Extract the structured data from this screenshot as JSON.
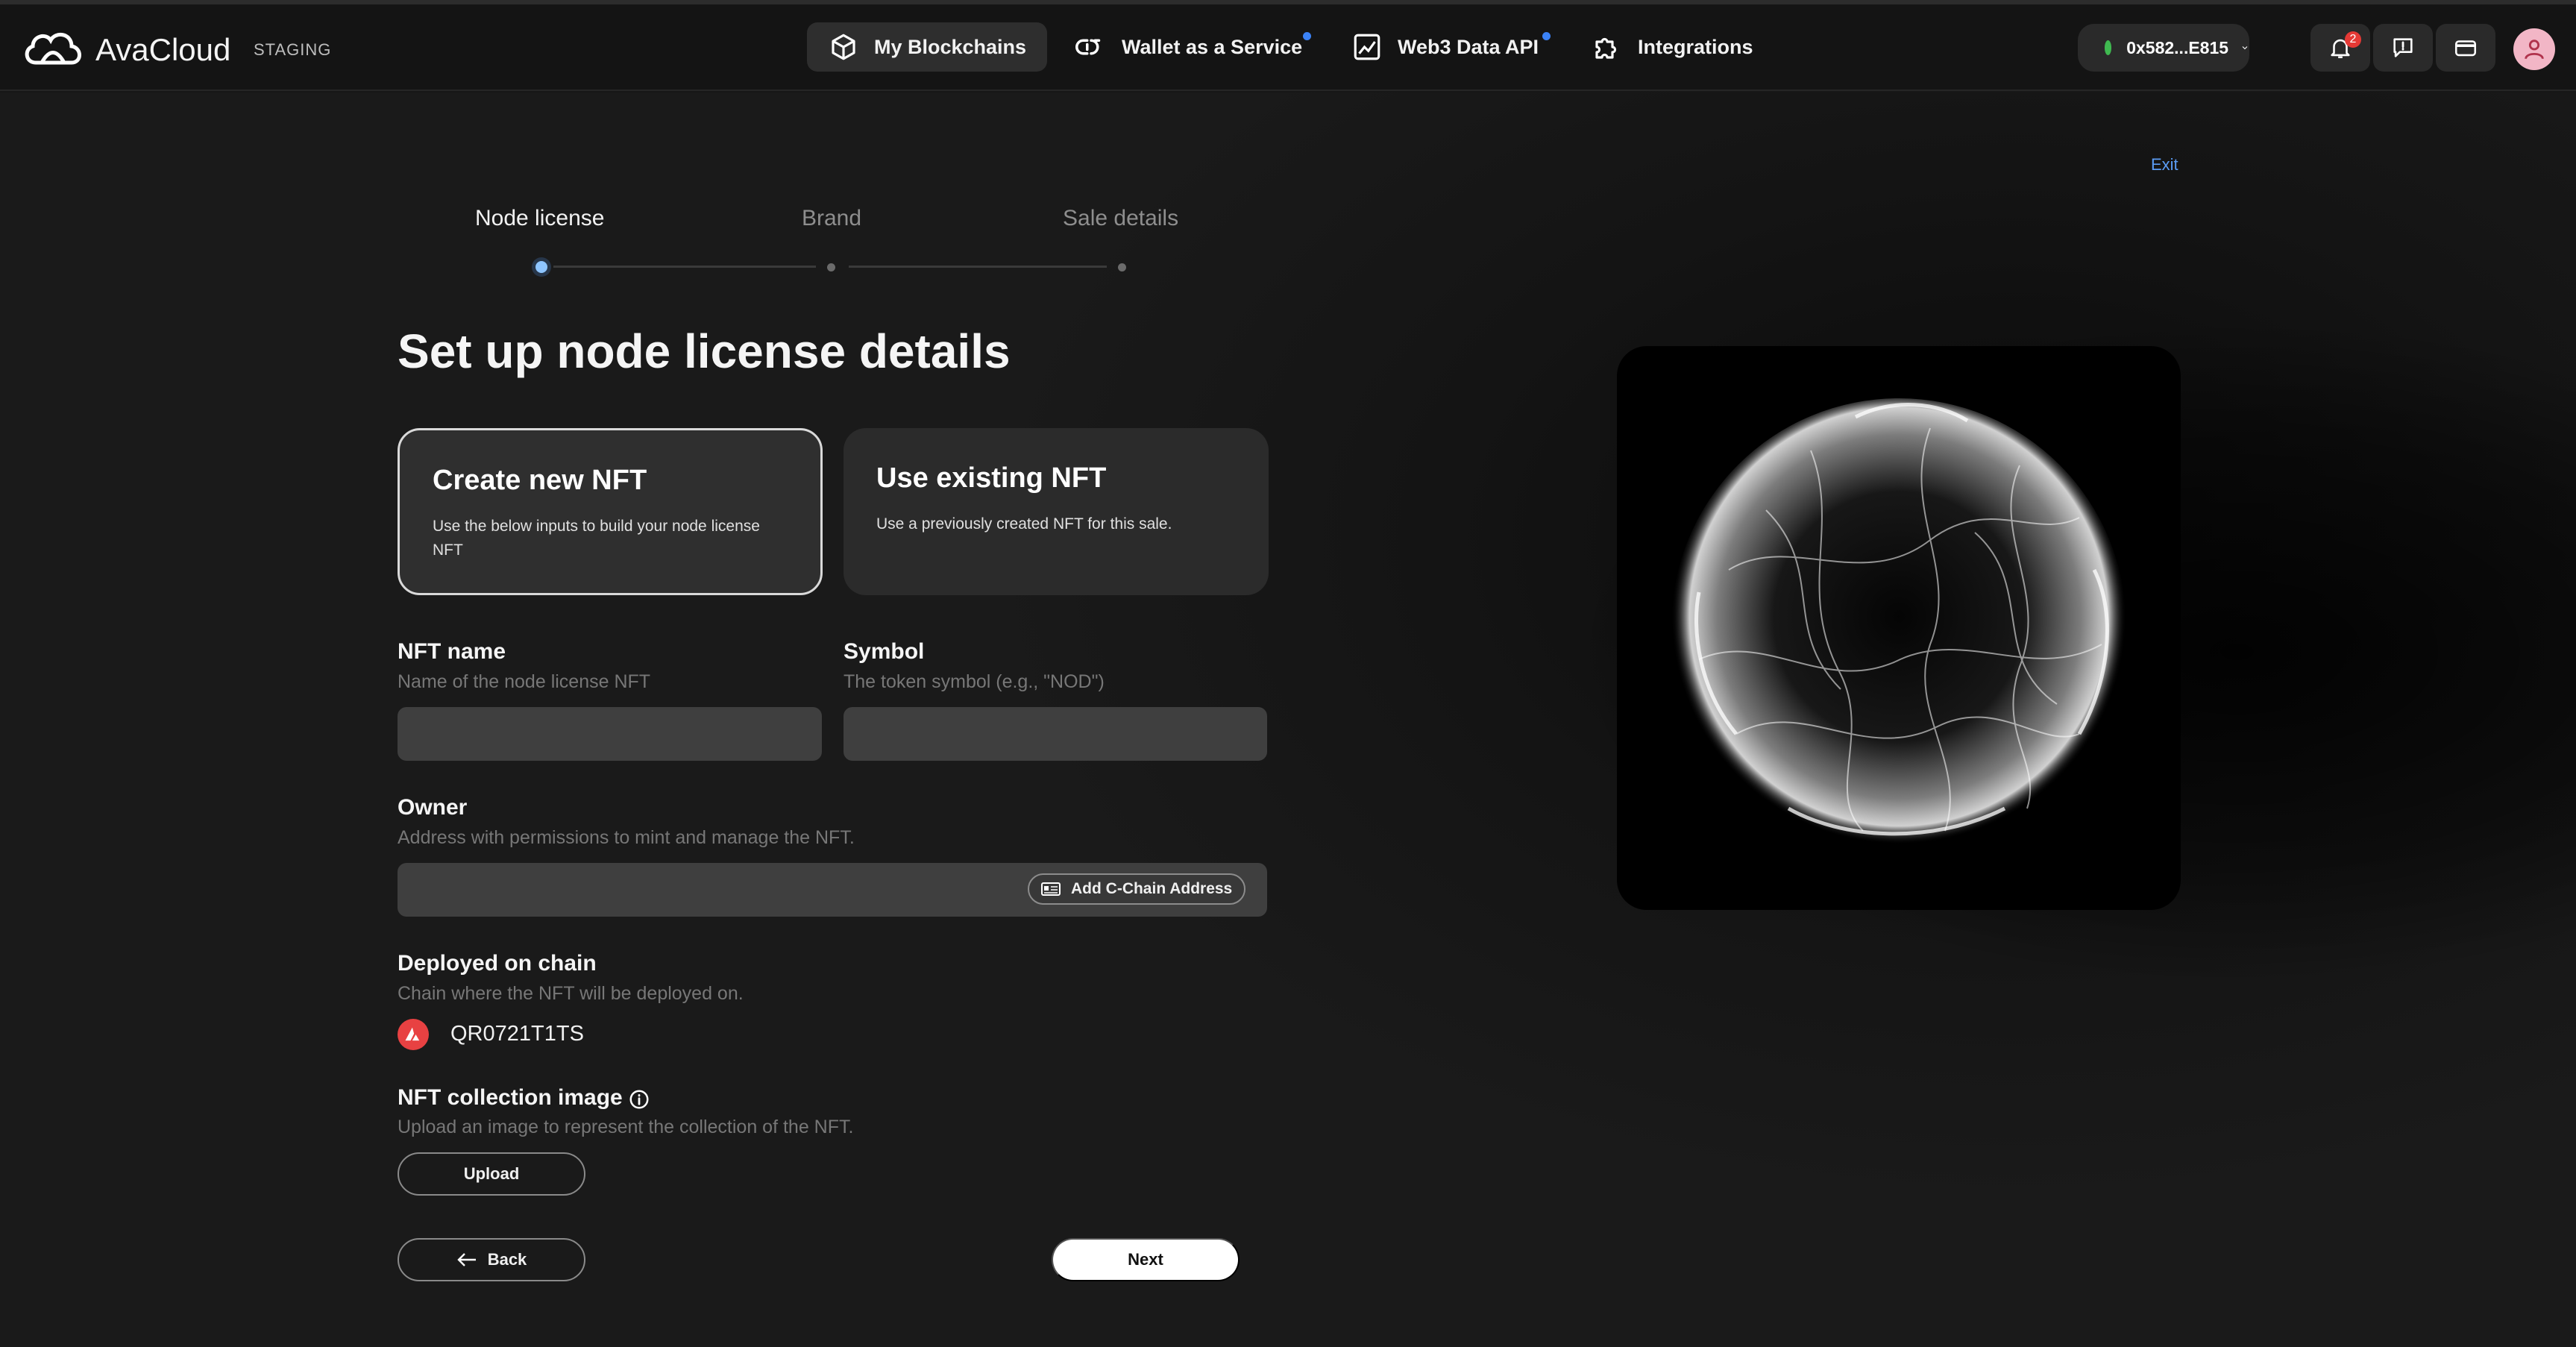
{
  "header": {
    "brand": "AvaCloud",
    "env_badge": "STAGING",
    "nav": [
      {
        "label": "My Blockchains",
        "icon": "cube-icon"
      },
      {
        "label": "Wallet as a Service",
        "icon": "wallet-link-icon"
      },
      {
        "label": "Web3 Data API",
        "icon": "chart-icon"
      },
      {
        "label": "Integrations",
        "icon": "puzzle-icon"
      }
    ],
    "wallet_address": "0x582...E815",
    "notification_count": "2"
  },
  "wizard": {
    "exit_label": "Exit",
    "steps": [
      "Node license",
      "Brand",
      "Sale details"
    ],
    "active_step": 0
  },
  "form": {
    "title": "Set up node license details",
    "options": [
      {
        "title": "Create new NFT",
        "description": "Use the below inputs to build your node license NFT",
        "selected": true
      },
      {
        "title": "Use existing NFT",
        "description": "Use a previously created NFT for this sale.",
        "selected": false
      }
    ],
    "nft_name": {
      "label": "NFT name",
      "hint": "Name of the node license NFT",
      "value": ""
    },
    "symbol": {
      "label": "Symbol",
      "hint": "The token symbol (e.g., \"NOD\")",
      "value": ""
    },
    "owner": {
      "label": "Owner",
      "hint": "Address with permissions to mint and manage the NFT.",
      "value": "",
      "add_address_label": "Add C-Chain Address"
    },
    "chain": {
      "label": "Deployed on chain",
      "hint": "Chain where the NFT will be deployed on.",
      "value": "QR0721T1TS"
    },
    "image": {
      "label": "NFT collection image",
      "hint": "Upload an image to represent the collection of the NFT.",
      "upload_label": "Upload"
    },
    "back_label": "Back",
    "next_label": "Next"
  },
  "colors": {
    "accent": "#3b82f6",
    "chain": "#e84142",
    "active_step": "#8ec5ff"
  }
}
